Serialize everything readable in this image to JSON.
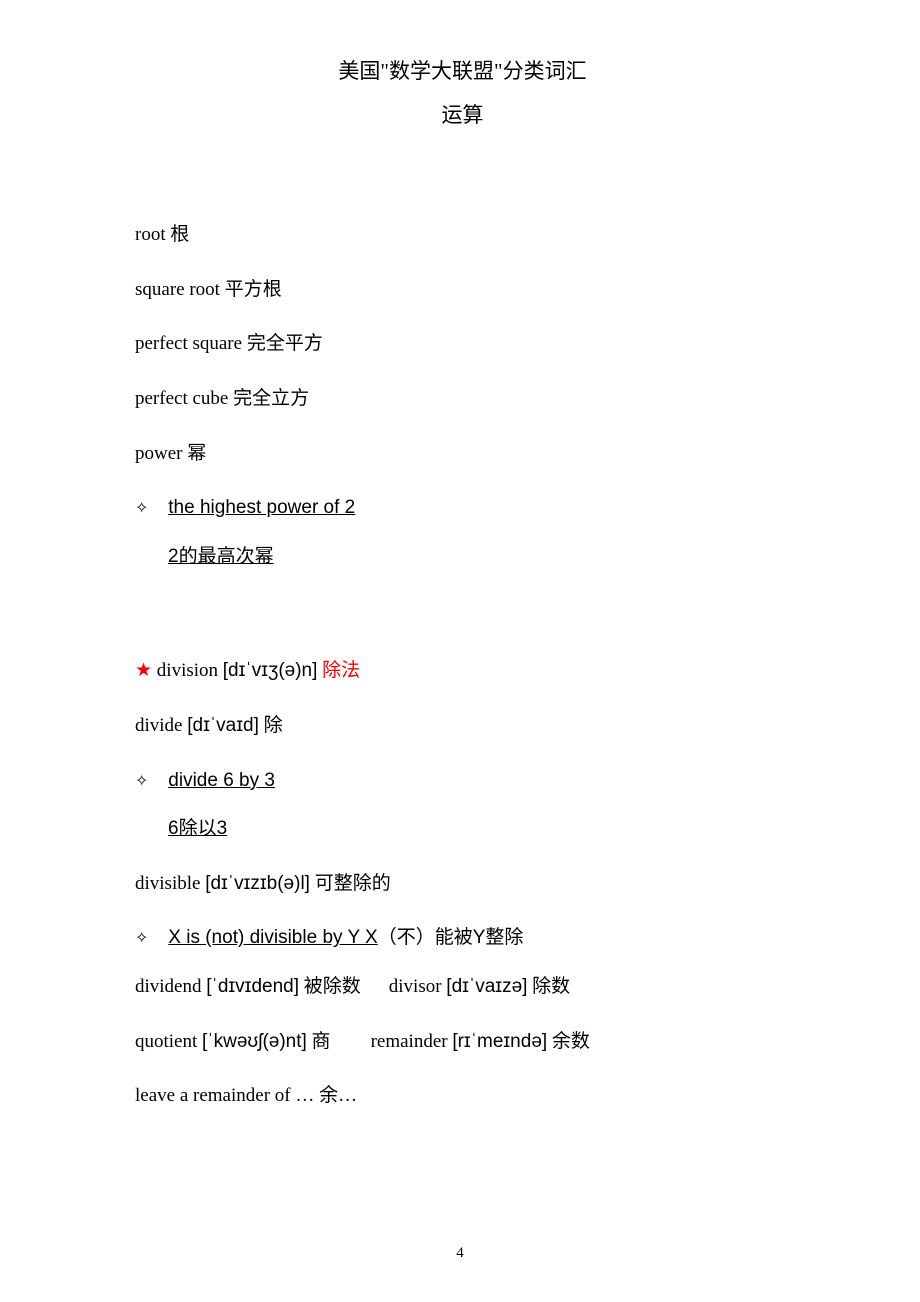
{
  "header": {
    "title": "美国\"数学大联盟\"分类词汇",
    "subtitle": "运算"
  },
  "lines": {
    "root_en": "root",
    "root_cn": " 根",
    "square_root_en": "square root",
    "square_root_cn": " 平方根",
    "perfect_square_en": "perfect square",
    "perfect_square_cn": " 完全平方",
    "perfect_cube_en": "perfect cube",
    "perfect_cube_cn": " 完全立方",
    "power_en": "power",
    "power_cn": " 幂",
    "ex_highest_power": "the highest power of 2",
    "ex_highest_power_cn": "2的最高次幂",
    "division_en": "division ",
    "division_ph": "[dɪˈvɪʒ(ə)n]",
    "division_cn": " 除法",
    "divide_en": "divide ",
    "divide_ph": "[dɪˈvaɪd]",
    "divide_cn": " 除",
    "ex_divide": "divide 6 by 3",
    "ex_divide_cn": "6除以3",
    "divisible_en": "divisible ",
    "divisible_ph": "[dɪˈvɪzɪb(ə)l]",
    "divisible_cn": " 可整除的",
    "ex_xy_1": "X is (not) divisible by Y",
    "ex_xy_2a": "   X",
    "ex_xy_2b": "（不）能被Y整除",
    "dividend_en": "dividend ",
    "dividend_ph": "[ˈdɪvɪdend]",
    "dividend_cn": " 被除数",
    "divisor_en": "divisor ",
    "divisor_ph": "[dɪˈvaɪzə]",
    "divisor_cn": " 除数",
    "quotient_en": "quotient ",
    "quotient_ph": "[ˈkwəʊʃ(ə)nt]",
    "quotient_cn": " 商",
    "remainder_en": "remainder ",
    "remainder_ph": "[rɪˈmeɪndə]",
    "remainder_cn": " 余数",
    "leave_en": "leave a remainder of …",
    "leave_cn": "    余…"
  },
  "glyphs": {
    "diamond": "✧",
    "star": "★ "
  },
  "page_number": "4"
}
